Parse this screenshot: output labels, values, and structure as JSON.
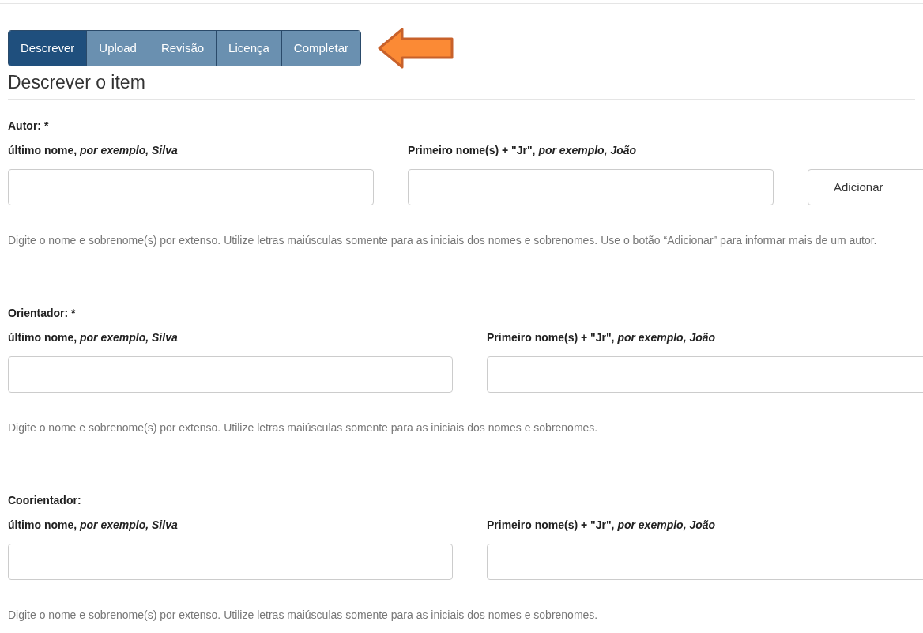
{
  "tabs": [
    {
      "label": "Descrever",
      "selected": true
    },
    {
      "label": "Upload",
      "selected": false
    },
    {
      "label": "Revisão",
      "selected": false
    },
    {
      "label": "Licença",
      "selected": false
    },
    {
      "label": "Completar",
      "selected": false
    }
  ],
  "heading": "Descrever o item",
  "sections": [
    {
      "label": "Autor: *",
      "fields": [
        {
          "label": "último nome, *por exemplo, Silva*"
        },
        {
          "label": "Primeiro nome(s) + \"Jr\", *por exemplo, João*"
        }
      ],
      "button": "Adicionar",
      "help": "Digite o nome e sobrenome(s) por extenso. Utilize letras maiúsculas somente para as iniciais dos nomes e sobrenomes. Use o botão “Adicionar” para informar mais de um autor."
    },
    {
      "label": "Orientador: *",
      "fields": [
        {
          "label": "último nome, *por exemplo, Silva*"
        },
        {
          "label": "Primeiro nome(s) + \"Jr\", *por exemplo, João*"
        }
      ],
      "help": "Digite o nome e sobrenome(s) por extenso. Utilize letras maiúsculas somente para as iniciais dos nomes e sobrenomes."
    },
    {
      "label": "Coorientador:",
      "fields": [
        {
          "label": "último nome, *por exemplo, Silva*"
        },
        {
          "label": "Primeiro nome(s) + \"Jr\", *por exemplo, João*"
        }
      ],
      "help": "Digite o nome e sobrenome(s) por extenso. Utilize letras maiúsculas somente para as iniciais dos nomes e sobrenomes."
    }
  ]
}
